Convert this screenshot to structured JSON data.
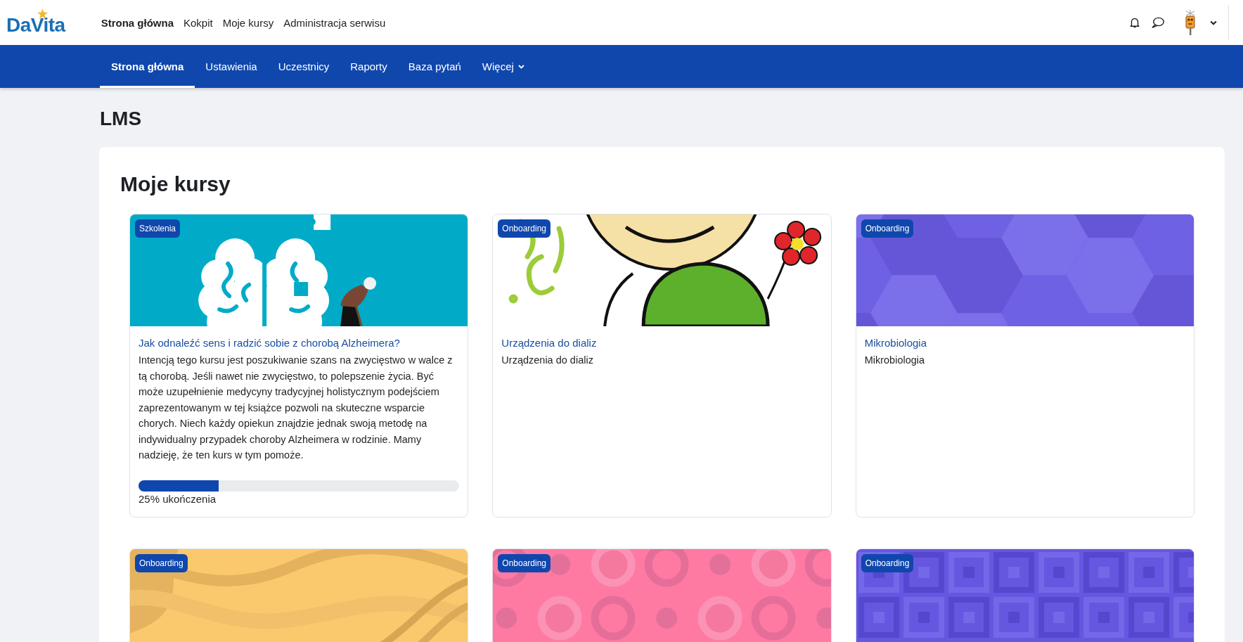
{
  "header": {
    "logo": "DaVita",
    "nav": [
      {
        "label": "Strona główna",
        "selected": true
      },
      {
        "label": "Kokpit",
        "selected": false
      },
      {
        "label": "Moje kursy",
        "selected": false
      },
      {
        "label": "Administracja serwisu",
        "selected": false
      }
    ]
  },
  "secondary_nav": [
    {
      "label": "Strona główna",
      "selected": true,
      "has_menu": false
    },
    {
      "label": "Ustawienia",
      "selected": false,
      "has_menu": false
    },
    {
      "label": "Uczestnicy",
      "selected": false,
      "has_menu": false
    },
    {
      "label": "Raporty",
      "selected": false,
      "has_menu": false
    },
    {
      "label": "Baza pytań",
      "selected": false,
      "has_menu": false
    },
    {
      "label": "Więcej",
      "selected": false,
      "has_menu": true
    }
  ],
  "page_title": "LMS",
  "section_title": "Moje kursy",
  "courses": [
    {
      "kind": "brain",
      "category": "Szkolenia",
      "title": "Jak odnaleźć sens i radzić sobie z chorobą Alzheimera?",
      "summary": "Intencją tego kursu jest poszukiwanie szans na zwycięstwo w walce z tą chorobą. Jeśli nawet nie zwycięstwo, to polepszenie życia. Być może uzupełnienie medycyny tradycyjnej holistycznym podejściem zaprezentowanym w tej książce pozwoli na skuteczne wsparcie chorych. Niech każdy opiekun znajdzie jednak swoją metodę na indywidualny przypadek choroby Alzheimera w rodzinie. Mamy nadzieję, że ten kurs w tym pomoże.",
      "progress": {
        "level": 0.25,
        "label": "25% ukończenia"
      }
    },
    {
      "kind": "cartoon",
      "category": "Onboarding",
      "title": "Urządzenia do dializ",
      "summary": "Urządzenia do dializ"
    },
    {
      "kind": "hexagons",
      "category": "Onboarding",
      "title": "Mikrobiologia",
      "summary": "Mikrobiologia"
    },
    {
      "kind": "waves",
      "category": "Onboarding"
    },
    {
      "kind": "circles",
      "category": "Onboarding"
    },
    {
      "kind": "squares",
      "category": "Onboarding"
    }
  ]
}
